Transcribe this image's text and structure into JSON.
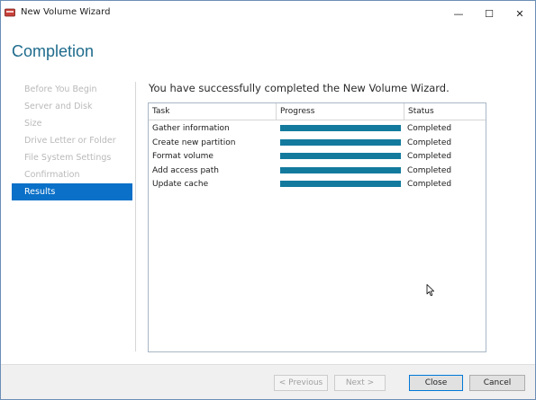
{
  "window": {
    "title": "New Volume Wizard",
    "controls": {
      "minimize": "—",
      "maximize": "☐",
      "close": "✕"
    }
  },
  "page": {
    "heading": "Completion",
    "message": "You have successfully completed the New Volume Wizard."
  },
  "nav": {
    "items": [
      {
        "label": "Before You Begin",
        "active": false
      },
      {
        "label": "Server and Disk",
        "active": false
      },
      {
        "label": "Size",
        "active": false
      },
      {
        "label": "Drive Letter or Folder",
        "active": false
      },
      {
        "label": "File System Settings",
        "active": false
      },
      {
        "label": "Confirmation",
        "active": false
      },
      {
        "label": "Results",
        "active": true
      }
    ]
  },
  "results_table": {
    "columns": [
      "Task",
      "Progress",
      "Status"
    ],
    "rows": [
      {
        "task": "Gather information",
        "progress": 1.0,
        "status": "Completed"
      },
      {
        "task": "Create new partition",
        "progress": 1.0,
        "status": "Completed"
      },
      {
        "task": "Format volume",
        "progress": 1.0,
        "status": "Completed"
      },
      {
        "task": "Add access path",
        "progress": 1.0,
        "status": "Completed"
      },
      {
        "task": "Update cache",
        "progress": 1.0,
        "status": "Completed"
      }
    ]
  },
  "buttons": {
    "previous": "< Previous",
    "next": "Next >",
    "close": "Close",
    "cancel": "Cancel"
  },
  "colors": {
    "accent": "#0a70c8",
    "heading": "#1e6b8c",
    "progress_fill": "#137a9e"
  }
}
